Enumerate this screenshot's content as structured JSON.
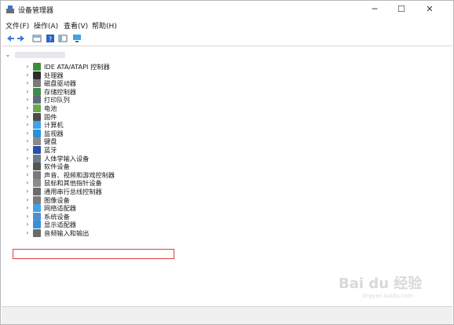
{
  "window": {
    "title": "设备管理器"
  },
  "title_buttons": {
    "minimize": "─",
    "maximize": "☐",
    "close": "✕"
  },
  "menu": [
    "文件(F)",
    "操作(A)",
    "查看(V)",
    "帮助(H)"
  ],
  "toolbar": [
    "back-icon",
    "forward-icon",
    "properties-icon",
    "help-icon",
    "computer-icon"
  ],
  "colors": {
    "highlight_border": "#e0413f",
    "icon_blue": "#2a7bd6",
    "icon_gray": "#6e6e6e"
  },
  "tree": {
    "root_expanded": true,
    "items": [
      {
        "label": "IDE ATA/ATAPI 控制器",
        "icon": "ide-controller-icon"
      },
      {
        "label": "处理器",
        "icon": "processor-icon"
      },
      {
        "label": "磁盘驱动器",
        "icon": "disk-drive-icon"
      },
      {
        "label": "存储控制器",
        "icon": "storage-controller-icon"
      },
      {
        "label": "打印队列",
        "icon": "print-queue-icon"
      },
      {
        "label": "电池",
        "icon": "battery-icon"
      },
      {
        "label": "固件",
        "icon": "firmware-icon"
      },
      {
        "label": "计算机",
        "icon": "computer-icon"
      },
      {
        "label": "监视器",
        "icon": "monitor-icon"
      },
      {
        "label": "键盘",
        "icon": "keyboard-icon"
      },
      {
        "label": "蓝牙",
        "icon": "bluetooth-icon"
      },
      {
        "label": "人体学输入设备",
        "icon": "hid-icon"
      },
      {
        "label": "软件设备",
        "icon": "software-device-icon"
      },
      {
        "label": "声音、视频和游戏控制器",
        "icon": "sound-icon"
      },
      {
        "label": "鼠标和其他指针设备",
        "icon": "mouse-icon"
      },
      {
        "label": "通用串行总线控制器",
        "icon": "usb-icon"
      },
      {
        "label": "图像设备",
        "icon": "imaging-icon"
      },
      {
        "label": "网络适配器",
        "icon": "network-adapter-icon"
      },
      {
        "label": "系统设备",
        "icon": "system-device-icon"
      },
      {
        "label": "显示适配器",
        "icon": "display-adapter-icon"
      },
      {
        "label": "音频输入和输出",
        "icon": "audio-io-icon"
      }
    ]
  },
  "watermark": {
    "text": "Bai du 经验",
    "sub": "jingyan.baidu.com"
  }
}
